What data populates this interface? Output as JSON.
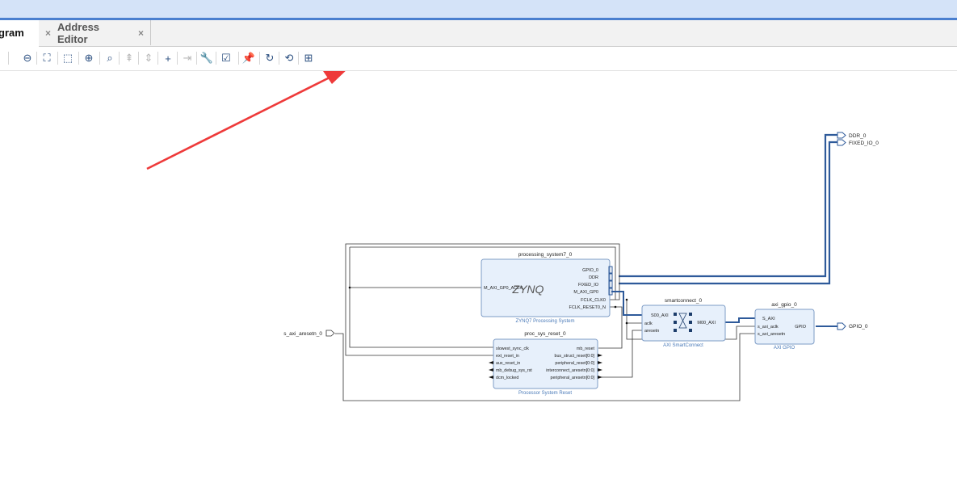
{
  "tabs": [
    {
      "label": "gram",
      "active": true
    },
    {
      "label": "Address Editor",
      "active": false
    }
  ],
  "close_glyph": "×",
  "toolbar_icons": [
    {
      "name": "zoom-out-icon",
      "glyph": "⊖",
      "enabled": true
    },
    {
      "name": "zoom-fit-icon",
      "glyph": "⛶",
      "enabled": true
    },
    {
      "name": "zoom-area-icon",
      "glyph": "⬚",
      "enabled": true
    },
    {
      "name": "center-icon",
      "glyph": "⊕",
      "enabled": true
    },
    {
      "name": "search-icon",
      "glyph": "⌕",
      "enabled": true
    },
    {
      "name": "collapse-icon",
      "glyph": "⇞",
      "enabled": false
    },
    {
      "name": "expand-icon",
      "glyph": "⇕",
      "enabled": false
    },
    {
      "name": "add-ip-icon",
      "glyph": "+",
      "enabled": true
    },
    {
      "name": "make-external-icon",
      "glyph": "⇥",
      "enabled": false
    },
    {
      "name": "properties-wrench-icon",
      "glyph": "🔧",
      "enabled": true
    },
    {
      "name": "validate-design-icon",
      "glyph": "☑",
      "enabled": true
    },
    {
      "name": "pin-icon",
      "glyph": "📌",
      "enabled": true
    },
    {
      "name": "regenerate-layout-icon",
      "glyph": "↻",
      "enabled": true
    },
    {
      "name": "optimize-routing-icon",
      "glyph": "⟲",
      "enabled": true
    },
    {
      "name": "port-icon",
      "glyph": "⊞",
      "enabled": true
    }
  ],
  "colors": {
    "accent": "#4a7fcf",
    "annotation_arrow": "#ee3a3a",
    "block_fill": "#e7f0fb",
    "block_border": "#7d9cc6",
    "bus_line": "#2e5a9a",
    "block_subtitle": "#4a7ab8"
  },
  "diagram": {
    "ext_ports_top": [
      "DDR_0",
      "FIXED_IO_0"
    ],
    "ps": {
      "instance": "processing_system7_0",
      "subtitle": "ZYNQ7 Processing System",
      "logo": "ZYNQ",
      "in_port": "M_AXI_GP0_ACLK",
      "out_ports": [
        "GPIO_0",
        "DDR",
        "FIXED_IO",
        "M_AXI_GP0",
        "FCLK_CLK0",
        "FCLK_RESET0_N"
      ]
    },
    "smartconnect": {
      "instance": "smartconnect_0",
      "subtitle": "AXI SmartConnect",
      "in_ports": [
        "S00_AXI",
        "aclk",
        "aresetn"
      ],
      "out_port": "M00_AXI"
    },
    "gpio": {
      "instance": "axi_gpio_0",
      "subtitle": "AXI GPIO",
      "in_ports": [
        "S_AXI",
        "s_axi_aclk",
        "s_axi_aresetn"
      ],
      "out_port": "GPIO"
    },
    "reset": {
      "instance": "proc_sys_reset_0",
      "subtitle": "Processor System Reset",
      "in_ports": [
        "slowest_sync_clk",
        "ext_reset_in",
        "aux_reset_in",
        "mb_debug_sys_rst",
        "dcm_locked"
      ],
      "out_ports": [
        "mb_reset",
        "bus_struct_reset[0:0]",
        "peripheral_reset[0:0]",
        "interconnect_aresetn[0:0]",
        "peripheral_aresetn[0:0]"
      ]
    },
    "ext_in_port": "s_axi_aresetn_0",
    "ext_out_port": "GPIO_0"
  }
}
